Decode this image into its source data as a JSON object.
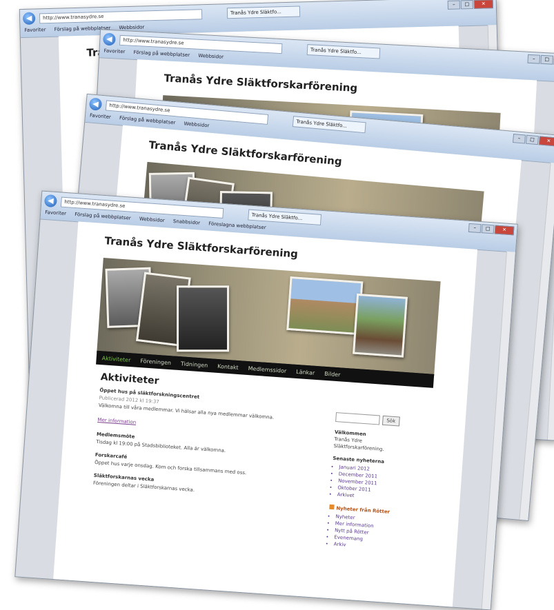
{
  "browser": {
    "address": "http://www.tranasydre.se",
    "tab_title": "Tranås Ydre Släktfo...",
    "favorites": [
      "Favoriter",
      "Förslag på webbplatser",
      "Webbsidor",
      "Snabbsidor",
      "Föreslagna webbplatser"
    ],
    "window_controls": [
      "–",
      "□",
      "✕"
    ]
  },
  "site": {
    "title": "Tranås Ydre Släktforskarförening",
    "nav": [
      "Aktiviteter",
      "Föreningen",
      "Tidningen",
      "Kontakt",
      "Medlemssidor",
      "Länkar",
      "Bilder"
    ]
  },
  "content": {
    "heading": "Aktiviteter",
    "subheading": "Öppet hus på släktforskningscentret",
    "meta": "Publicerad 2012 kl 19:37",
    "p1": "Välkomna till våra medlemmar. Vi hälsar alla nya medlemmar välkomna.",
    "link": "Mer information",
    "section2": "Medlemsmöte",
    "p2": "Tisdag kl 19:00 på Stadsbiblioteket. Alla är välkomna.",
    "section3": "Forskarcafé",
    "p3": "Öppet hus varje onsdag. Kom och forska tillsammans med oss.",
    "section4": "Släktforskarnas vecka",
    "p4": "Föreningen deltar i Släktforskarnas vecka."
  },
  "sidebar": {
    "search_button": "Sök",
    "about_heading": "Välkommen",
    "about_text": "Tranås Ydre Släktforskarförening.",
    "archive_heading": "Senaste nyheterna",
    "archive": [
      "Januari 2012",
      "December 2011",
      "November 2011",
      "Oktober 2011",
      "Arkivet"
    ],
    "news_heading": "Nyheter från Rötter",
    "news": [
      "Nyheter",
      "Mer information",
      "Nytt på Rötter",
      "Evenemang",
      "Arkiv"
    ]
  }
}
